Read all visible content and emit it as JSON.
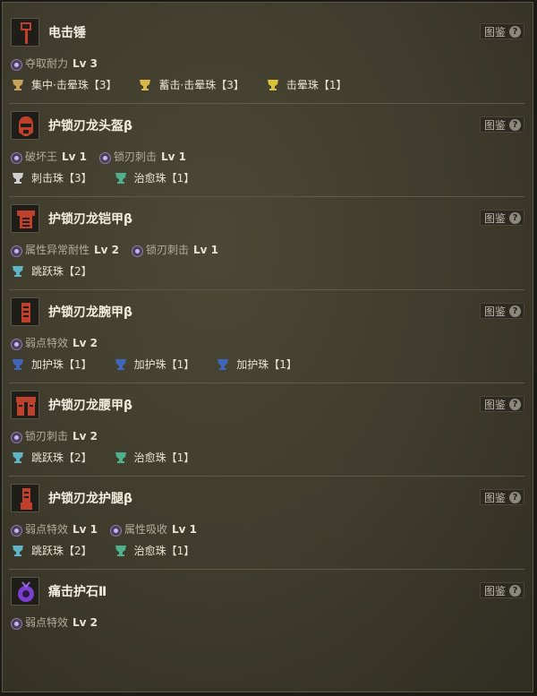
{
  "dict_label": "图鉴",
  "help_glyph": "?",
  "items": [
    {
      "name": "电击锤",
      "icon": "hammer-icon",
      "skills": [
        {
          "name": "夺取耐力",
          "level": "Lv 3"
        }
      ],
      "decorations": [
        {
          "name": "集中·击晕珠【3】",
          "color": "#c9a35a"
        },
        {
          "name": "蓄击·击晕珠【3】",
          "color": "#d7b64a"
        },
        {
          "name": "击晕珠【1】",
          "color": "#d9c23a"
        }
      ]
    },
    {
      "name": "护锁刃龙头盔β",
      "icon": "helmet-icon",
      "skills": [
        {
          "name": "破坏王",
          "level": "Lv 1"
        },
        {
          "name": "锁刃刺击",
          "level": "Lv 1"
        }
      ],
      "decorations": [
        {
          "name": "刺击珠【3】",
          "color": "#cfcfcf"
        },
        {
          "name": "治愈珠【1】",
          "color": "#4fb08e"
        }
      ]
    },
    {
      "name": "护锁刃龙铠甲β",
      "icon": "chest-armor-icon",
      "skills": [
        {
          "name": "属性异常耐性",
          "level": "Lv 2"
        },
        {
          "name": "锁刃刺击",
          "level": "Lv 1"
        }
      ],
      "decorations": [
        {
          "name": "跳跃珠【2】",
          "color": "#5fb3c4"
        }
      ]
    },
    {
      "name": "护锁刃龙腕甲β",
      "icon": "arm-armor-icon",
      "skills": [
        {
          "name": "弱点特效",
          "level": "Lv 2"
        }
      ],
      "decorations": [
        {
          "name": "加护珠【1】",
          "color": "#3f66b8"
        },
        {
          "name": "加护珠【1】",
          "color": "#3f66b8"
        },
        {
          "name": "加护珠【1】",
          "color": "#3f66b8"
        }
      ]
    },
    {
      "name": "护锁刃龙腰甲β",
      "icon": "waist-armor-icon",
      "skills": [
        {
          "name": "锁刃刺击",
          "level": "Lv 2"
        }
      ],
      "decorations": [
        {
          "name": "跳跃珠【2】",
          "color": "#5fb3c4"
        },
        {
          "name": "治愈珠【1】",
          "color": "#4fb08e"
        }
      ]
    },
    {
      "name": "护锁刃龙护腿β",
      "icon": "leg-armor-icon",
      "skills": [
        {
          "name": "弱点特效",
          "level": "Lv 1"
        },
        {
          "name": "属性吸收",
          "level": "Lv 1"
        }
      ],
      "decorations": [
        {
          "name": "跳跃珠【2】",
          "color": "#5fb3c4"
        },
        {
          "name": "治愈珠【1】",
          "color": "#4fb08e"
        }
      ]
    },
    {
      "name": "痛击护石Ⅱ",
      "icon": "charm-icon",
      "skills": [
        {
          "name": "弱点特效",
          "level": "Lv 2"
        }
      ],
      "decorations": []
    }
  ]
}
